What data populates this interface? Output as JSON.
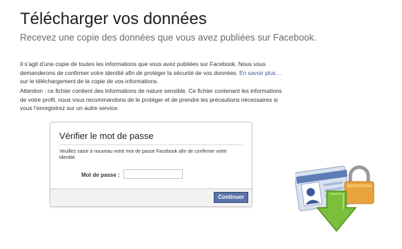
{
  "header": {
    "title": "Télécharger vos données",
    "subtitle": "Recevez une copie des données que vous avez publiées sur Facebook."
  },
  "intro": {
    "p1_before_link": "Il s’agit d’une copie de toutes les informations que vous avez publiées sur Facebook. Nous vous demanderons de confirmer votre identité afin de protéger la sécurité de vos données. ",
    "learn_more_link": "En savoir plus…",
    "p1_after_link": " sur le téléchargement de la copie de vos informations.",
    "p2": "Attention : ce fichier contient des informations de nature sensible. Ce fichier contenant les informations de votre profil, nous vous recommandons de le protéger et de prendre les précautions nécessaires si vous l’enregistrez sur un autre service."
  },
  "dialog": {
    "title": "Vérifier le mot de passe",
    "instructions": "Veuillez saisir à nouveau votre mot de passe Facebook afin de confirmer votre identité.",
    "password_label": "Mot de passe :",
    "password_value": "",
    "continue_label": "Continuer"
  },
  "illustration": {
    "icons": [
      "id-card-icon",
      "padlock-icon",
      "download-arrow-icon"
    ],
    "colors": {
      "arrow": "#7bbf3a",
      "lock": "#e8a33c",
      "card": "#5d7db5"
    }
  }
}
